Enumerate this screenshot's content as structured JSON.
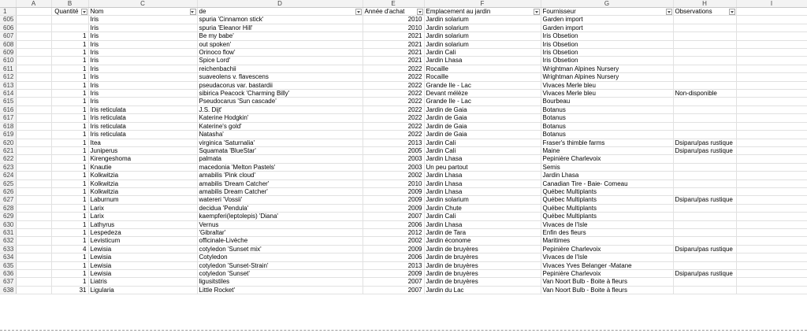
{
  "columns": [
    "A",
    "B",
    "C",
    "D",
    "E",
    "F",
    "G",
    "H",
    "I"
  ],
  "header_row": {
    "row": "1",
    "cells": [
      "",
      "Quantité",
      "Nom",
      "de",
      "Année d'achat",
      "Emplacement au jardin",
      "Fournisseur",
      "Observations",
      ""
    ]
  },
  "rows": [
    {
      "row": "605",
      "qty": "",
      "nom": "Iris",
      "de": "spuria 'Cinnamon stick'",
      "annee": "2010",
      "emplacement": "Jardin solarium",
      "fournisseur": "Garden import",
      "obs": ""
    },
    {
      "row": "606",
      "qty": "",
      "nom": "Iris",
      "de": "spuria 'Eleanor Hill'",
      "annee": "2010",
      "emplacement": "Jardin solarium",
      "fournisseur": "Garden import",
      "obs": ""
    },
    {
      "row": "607",
      "qty": "1",
      "nom": "Iris",
      "de": "Be my babe'",
      "annee": "2021",
      "emplacement": "Jardin solarium",
      "fournisseur": "Iris Obsetion",
      "obs": ""
    },
    {
      "row": "608",
      "qty": "1",
      "nom": "Iris",
      "de": "out spoken'",
      "annee": "2021",
      "emplacement": "Jardin solarium",
      "fournisseur": "Iris Obsetion",
      "obs": ""
    },
    {
      "row": "609",
      "qty": "1",
      "nom": "Iris",
      "de": "Orinoco flow'",
      "annee": "2021",
      "emplacement": "Jardin Cali",
      "fournisseur": "Iris Obsetion",
      "obs": ""
    },
    {
      "row": "610",
      "qty": "1",
      "nom": "Iris",
      "de": "Spice Lord'",
      "annee": "2021",
      "emplacement": "Jardin Lhasa",
      "fournisseur": "Iris Obsetion",
      "obs": ""
    },
    {
      "row": "611",
      "qty": "1",
      "nom": "Iris",
      "de": "reichenbachii",
      "annee": "2022",
      "emplacement": "Rocaille",
      "fournisseur": "Wrightman Alpines Nursery",
      "obs": ""
    },
    {
      "row": "612",
      "qty": "1",
      "nom": "Iris",
      "de": "suaveolens v. flavescens",
      "annee": "2022",
      "emplacement": "Rocaille",
      "fournisseur": "Wrightman Alpines Nursery",
      "obs": ""
    },
    {
      "row": "613",
      "qty": "1",
      "nom": "Iris",
      "de": "pseudacorus var. bastardii",
      "annee": "2022",
      "emplacement": "Grande Ile - Lac",
      "fournisseur": "Vivaces Merle bleu",
      "obs": ""
    },
    {
      "row": "614",
      "qty": "1",
      "nom": "Iris",
      "de": "sibirica Peacock 'Charming Billy'",
      "annee": "2022",
      "emplacement": "Devant mélèze",
      "fournisseur": "Vivaces Merle bleu",
      "obs": "Non-disponible"
    },
    {
      "row": "615",
      "qty": "1",
      "nom": "Iris",
      "de": "Pseudocarus 'Sun cascade'",
      "annee": "2022",
      "emplacement": "Grande Ile - Lac",
      "fournisseur": "Bourbeau",
      "obs": ""
    },
    {
      "row": "616",
      "qty": "1",
      "nom": "Iris reticulata",
      "de": "J.S. Dijt'",
      "annee": "2022",
      "emplacement": "Jardin de Gaia",
      "fournisseur": "Botanus",
      "obs": ""
    },
    {
      "row": "617",
      "qty": "1",
      "nom": "Iris reticulata",
      "de": "Katerine Hodgkin'",
      "annee": "2022",
      "emplacement": "Jardin de Gaia",
      "fournisseur": "Botanus",
      "obs": ""
    },
    {
      "row": "618",
      "qty": "1",
      "nom": "Iris reticulata",
      "de": "Katerine's gold'",
      "annee": "2022",
      "emplacement": "Jardin de Gaia",
      "fournisseur": "Botanus",
      "obs": ""
    },
    {
      "row": "619",
      "qty": "1",
      "nom": "Iris reticulata",
      "de": "Natasha'",
      "annee": "2022",
      "emplacement": "Jardin de Gaia",
      "fournisseur": "Botanus",
      "obs": ""
    },
    {
      "row": "620",
      "qty": "1",
      "nom": "Itea",
      "de": "virginica 'Saturnalia'",
      "annee": "2013",
      "emplacement": "Jardin Cali",
      "fournisseur": "Fraser's thimble farms",
      "obs": "Dsiparu/pas rustique"
    },
    {
      "row": "621",
      "qty": "1",
      "nom": "Juniperus",
      "de": "Squamata 'BlueStar'",
      "annee": "2005",
      "emplacement": "Jardin Cali",
      "fournisseur": "Maine",
      "obs": "Dsiparu/pas rustique"
    },
    {
      "row": "622",
      "qty": "1",
      "nom": "Kirengeshoma",
      "de": "palmata",
      "annee": "2003",
      "emplacement": "Jardin Lhasa",
      "fournisseur": "Pepinière Charlevoix",
      "obs": ""
    },
    {
      "row": "623",
      "qty": "1",
      "nom": "Knautie",
      "de": "macedonia 'Melton Pastels'",
      "annee": "2003",
      "emplacement": "Un peu partout",
      "fournisseur": "Semis",
      "obs": ""
    },
    {
      "row": "624",
      "qty": "1",
      "nom": "Kolkwitzia",
      "de": "amabilis 'Pink cloud'",
      "annee": "2002",
      "emplacement": "Jardin Lhasa",
      "fournisseur": "Jardin Lhasa",
      "obs": ""
    },
    {
      "row": "625",
      "qty": "1",
      "nom": "Kolkwitzia",
      "de": "amabilis 'Dream Catcher'",
      "annee": "2010",
      "emplacement": "Jardin Lhasa",
      "fournisseur": "Canadian Tire - Baie- Comeau",
      "obs": ""
    },
    {
      "row": "626",
      "qty": "1",
      "nom": "Kolkwitzia",
      "de": "amabilis Dream Catcher'",
      "annee": "2009",
      "emplacement": "Jardin Lhasa",
      "fournisseur": "Québec Multiplants",
      "obs": ""
    },
    {
      "row": "627",
      "qty": "1",
      "nom": "Laburnum",
      "de": "watereri 'Vossii'",
      "annee": "2009",
      "emplacement": "Jardin solarium",
      "fournisseur": "Québec Multiplants",
      "obs": "Dsiparu/pas rustique"
    },
    {
      "row": "628",
      "qty": "1",
      "nom": "Larix",
      "de": "decidua 'Pendula'",
      "annee": "2009",
      "emplacement": "Jardin Chute",
      "fournisseur": "Québec Multiplants",
      "obs": ""
    },
    {
      "row": "629",
      "qty": "1",
      "nom": "Larix",
      "de": "kaempferi(leptolepis) 'Diana'",
      "annee": "2007",
      "emplacement": "Jardin Cali",
      "fournisseur": "Québec Multiplants",
      "obs": ""
    },
    {
      "row": "630",
      "qty": "1",
      "nom": "Lathyrus",
      "de": "Vernus",
      "annee": "2006",
      "emplacement": "Jardin Lhasa",
      "fournisseur": "Vivaces de l'Isle",
      "obs": ""
    },
    {
      "row": "631",
      "qty": "1",
      "nom": "Lespedeza",
      "de": "'Gibraltar'",
      "annee": "2012",
      "emplacement": "Jardin de Tara",
      "fournisseur": "Enfin des fleurs",
      "obs": ""
    },
    {
      "row": "632",
      "qty": "1",
      "nom": "Levisticum",
      "de": "officinale-Livèche",
      "annee": "2002",
      "emplacement": "Jardin économe",
      "fournisseur": "Maritimes",
      "obs": ""
    },
    {
      "row": "633",
      "qty": "4",
      "nom": "Lewisia",
      "de": "cotyledon 'Sunset mix'",
      "annee": "2009",
      "emplacement": "Jardin de bruyères",
      "fournisseur": "Pepinière Charlevoix",
      "obs": "Dsiparu/pas rustique"
    },
    {
      "row": "634",
      "qty": "1",
      "nom": "Lewisia",
      "de": "Cotyledon",
      "annee": "2006",
      "emplacement": "Jardin de bruyères",
      "fournisseur": "Vivaces de l'Isle",
      "obs": ""
    },
    {
      "row": "635",
      "qty": "1",
      "nom": "Lewisia",
      "de": "cotyledon 'Sunset-Strain'",
      "annee": "2013",
      "emplacement": "Jardin de bruyères",
      "fournisseur": "Vivaces Yves Belanger -Matane",
      "obs": ""
    },
    {
      "row": "636",
      "qty": "1",
      "nom": "Lewisia",
      "de": "cotyledon 'Sunset'",
      "annee": "2009",
      "emplacement": "Jardin de bruyères",
      "fournisseur": "Pepinière Charlevoix",
      "obs": "Dsiparu/pas rustique"
    },
    {
      "row": "637",
      "qty": "1",
      "nom": "Liatris",
      "de": "ligusitstiles",
      "annee": "2007",
      "emplacement": "Jardin de bruyères",
      "fournisseur": "Van Noort Bulb - Boite à fleurs",
      "obs": ""
    },
    {
      "row": "638",
      "qty": "31",
      "nom": "Ligularia",
      "de": "Little Rocket'",
      "annee": "2007",
      "emplacement": "Jardin du Lac",
      "fournisseur": "Van Noort Bulb - Boite à fleurs",
      "obs": ""
    }
  ]
}
